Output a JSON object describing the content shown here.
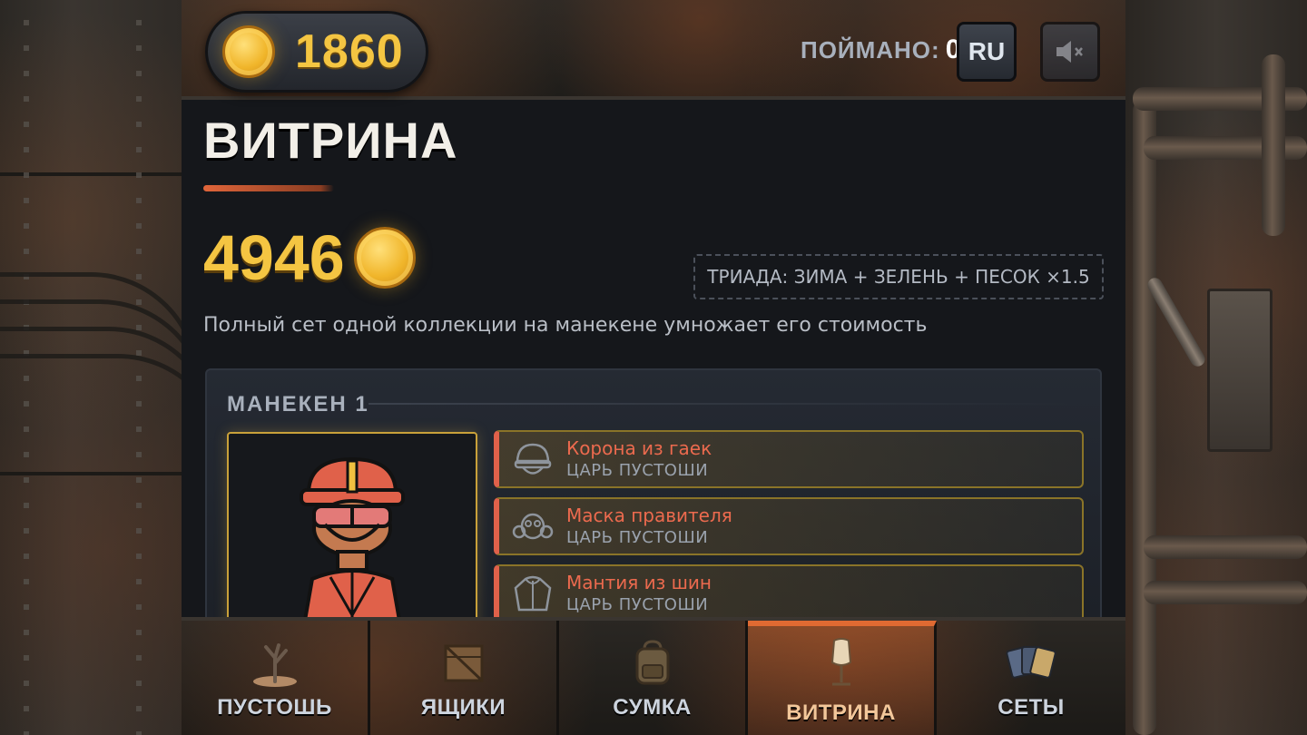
{
  "header": {
    "coins": "1860",
    "caught_label": "ПОЙМАНО:",
    "caught_value": "0",
    "language": "RU",
    "mute_icon": "speaker-muted-icon"
  },
  "page": {
    "title": "ВИТРИНА",
    "total_value": "4946",
    "triad_bonus": "ТРИАДА: ЗИМА + ЗЕЛЕНЬ + ПЕСОК ×1.5",
    "hint": "Полный сет одной коллекции на манекене умножает его стоимость"
  },
  "mannequin": {
    "title": "МАНЕКЕН 1",
    "items": [
      {
        "name": "Корона из гаек",
        "collection": "ЦАРЬ ПУСТОШИ",
        "icon": "helmet-icon"
      },
      {
        "name": "Маска правителя",
        "collection": "ЦАРЬ ПУСТОШИ",
        "icon": "gas-mask-icon"
      },
      {
        "name": "Мантия из шин",
        "collection": "ЦАРЬ ПУСТОШИ",
        "icon": "jacket-icon"
      }
    ]
  },
  "nav": {
    "tabs": [
      {
        "label": "ПУСТОШЬ",
        "icon": "dead-tree-icon"
      },
      {
        "label": "ЯЩИКИ",
        "icon": "crate-icon"
      },
      {
        "label": "СУМКА",
        "icon": "backpack-icon"
      },
      {
        "label": "ВИТРИНА",
        "icon": "mannequin-icon",
        "active": true
      },
      {
        "label": "СЕТЫ",
        "icon": "cards-icon"
      }
    ]
  },
  "colors": {
    "accent": "#e06a32",
    "gold": "#f4c542",
    "item_name": "#ec6a4e"
  }
}
